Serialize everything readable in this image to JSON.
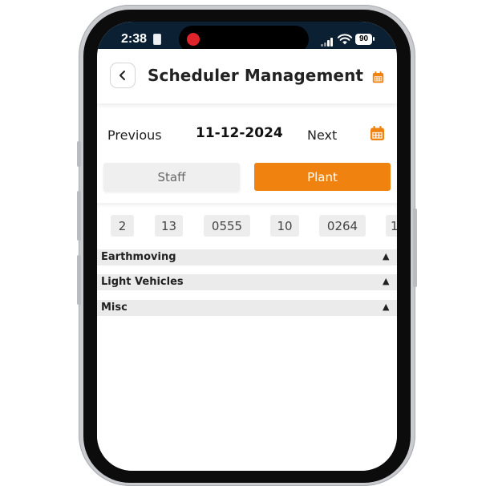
{
  "status_bar": {
    "time": "2:38",
    "battery": "90"
  },
  "header": {
    "title": "Scheduler Management",
    "back_icon": "chevron-left-icon",
    "calendar_icon": "calendar-icon"
  },
  "date_nav": {
    "previous_label": "Previous",
    "date": "11-12-2024",
    "next_label": "Next",
    "calendar_icon": "calendar-icon"
  },
  "segments": {
    "staff_label": "Staff",
    "plant_label": "Plant",
    "selected": "Plant"
  },
  "chips": [
    "2",
    "13",
    "0555",
    "10",
    "0264",
    "1"
  ],
  "sections": [
    {
      "label": "Earthmoving"
    },
    {
      "label": "Light Vehicles"
    },
    {
      "label": "Misc"
    }
  ],
  "colors": {
    "accent": "#f0820f",
    "status_bar": "#0b2033",
    "record_dot": "#e0242b"
  }
}
